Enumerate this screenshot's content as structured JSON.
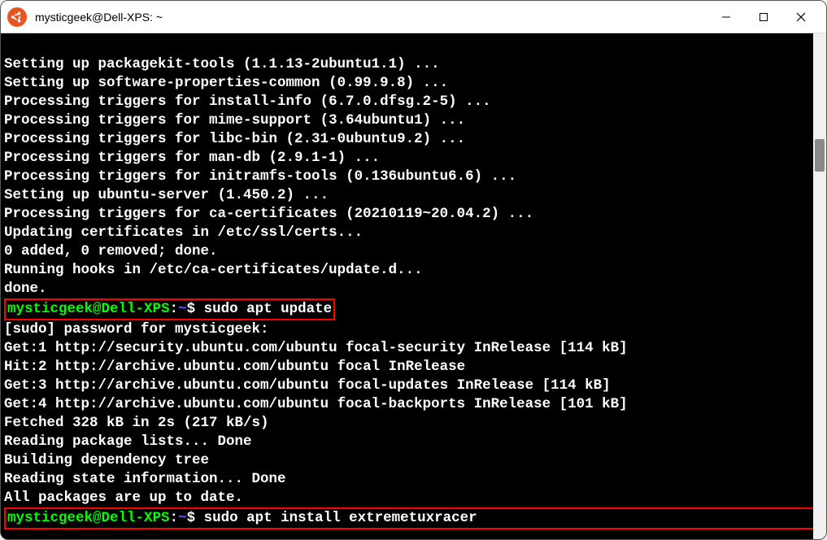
{
  "window": {
    "title": "mysticgeek@Dell-XPS: ~"
  },
  "prompt": {
    "user_host": "mysticgeek@Dell-XPS",
    "colon": ":",
    "path": "~",
    "dollar": "$"
  },
  "lines": [
    "Setting up packagekit-tools (1.1.13-2ubuntu1.1) ...",
    "Setting up software-properties-common (0.99.9.8) ...",
    "Processing triggers for install-info (6.7.0.dfsg.2-5) ...",
    "Processing triggers for mime-support (3.64ubuntu1) ...",
    "Processing triggers for libc-bin (2.31-0ubuntu9.2) ...",
    "Processing triggers for man-db (2.9.1-1) ...",
    "Processing triggers for initramfs-tools (0.136ubuntu6.6) ...",
    "Setting up ubuntu-server (1.450.2) ...",
    "Processing triggers for ca-certificates (20210119~20.04.2) ...",
    "Updating certificates in /etc/ssl/certs...",
    "0 added, 0 removed; done.",
    "Running hooks in /etc/ca-certificates/update.d...",
    "done."
  ],
  "command1": " sudo apt update",
  "output2": [
    "[sudo] password for mysticgeek:",
    "Get:1 http://security.ubuntu.com/ubuntu focal-security InRelease [114 kB]",
    "Hit:2 http://archive.ubuntu.com/ubuntu focal InRelease",
    "Get:3 http://archive.ubuntu.com/ubuntu focal-updates InRelease [114 kB]",
    "Get:4 http://archive.ubuntu.com/ubuntu focal-backports InRelease [101 kB]",
    "Fetched 328 kB in 2s (217 kB/s)",
    "Reading package lists... Done",
    "Building dependency tree",
    "Reading state information... Done",
    "All packages are up to date."
  ],
  "command2": " sudo apt install extremetuxracer"
}
